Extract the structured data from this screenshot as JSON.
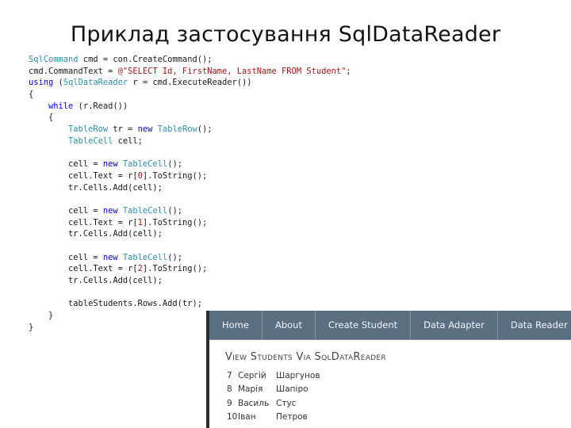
{
  "slide": {
    "title": "Приклад застосування SqlDataReader"
  },
  "code": [
    [
      {
        "t": "type",
        "v": "SqlCommand"
      },
      {
        "t": "plain",
        "v": " cmd = con.CreateCommand();"
      }
    ],
    [
      {
        "t": "plain",
        "v": "cmd.CommandText = "
      },
      {
        "t": "str",
        "v": "@\"SELECT Id, FirstName, LastName FROM Student\""
      },
      {
        "t": "plain",
        "v": ";"
      }
    ],
    [
      {
        "t": "kw",
        "v": "using"
      },
      {
        "t": "plain",
        "v": " ("
      },
      {
        "t": "type",
        "v": "SqlDataReader"
      },
      {
        "t": "plain",
        "v": " r = cmd.ExecuteReader())"
      }
    ],
    [
      {
        "t": "plain",
        "v": "{"
      }
    ],
    [
      {
        "t": "plain",
        "v": "    "
      },
      {
        "t": "kw",
        "v": "while"
      },
      {
        "t": "plain",
        "v": " (r.Read())"
      }
    ],
    [
      {
        "t": "plain",
        "v": "    {"
      }
    ],
    [
      {
        "t": "plain",
        "v": "        "
      },
      {
        "t": "type",
        "v": "TableRow"
      },
      {
        "t": "plain",
        "v": " tr = "
      },
      {
        "t": "kw",
        "v": "new"
      },
      {
        "t": "plain",
        "v": " "
      },
      {
        "t": "type",
        "v": "TableRow"
      },
      {
        "t": "plain",
        "v": "();"
      }
    ],
    [
      {
        "t": "plain",
        "v": "        "
      },
      {
        "t": "type",
        "v": "TableCell"
      },
      {
        "t": "plain",
        "v": " cell;"
      }
    ],
    [
      {
        "t": "plain",
        "v": ""
      }
    ],
    [
      {
        "t": "plain",
        "v": "        cell = "
      },
      {
        "t": "kw",
        "v": "new"
      },
      {
        "t": "plain",
        "v": " "
      },
      {
        "t": "type",
        "v": "TableCell"
      },
      {
        "t": "plain",
        "v": "();"
      }
    ],
    [
      {
        "t": "plain",
        "v": "        cell.Text = r["
      },
      {
        "t": "str",
        "v": "0"
      },
      {
        "t": "plain",
        "v": "].ToString();"
      }
    ],
    [
      {
        "t": "plain",
        "v": "        tr.Cells.Add(cell);"
      }
    ],
    [
      {
        "t": "plain",
        "v": ""
      }
    ],
    [
      {
        "t": "plain",
        "v": "        cell = "
      },
      {
        "t": "kw",
        "v": "new"
      },
      {
        "t": "plain",
        "v": " "
      },
      {
        "t": "type",
        "v": "TableCell"
      },
      {
        "t": "plain",
        "v": "();"
      }
    ],
    [
      {
        "t": "plain",
        "v": "        cell.Text = r["
      },
      {
        "t": "str",
        "v": "1"
      },
      {
        "t": "plain",
        "v": "].ToString();"
      }
    ],
    [
      {
        "t": "plain",
        "v": "        tr.Cells.Add(cell);"
      }
    ],
    [
      {
        "t": "plain",
        "v": ""
      }
    ],
    [
      {
        "t": "plain",
        "v": "        cell = "
      },
      {
        "t": "kw",
        "v": "new"
      },
      {
        "t": "plain",
        "v": " "
      },
      {
        "t": "type",
        "v": "TableCell"
      },
      {
        "t": "plain",
        "v": "();"
      }
    ],
    [
      {
        "t": "plain",
        "v": "        cell.Text = r["
      },
      {
        "t": "str",
        "v": "2"
      },
      {
        "t": "plain",
        "v": "].ToString();"
      }
    ],
    [
      {
        "t": "plain",
        "v": "        tr.Cells.Add(cell);"
      }
    ],
    [
      {
        "t": "plain",
        "v": ""
      }
    ],
    [
      {
        "t": "plain",
        "v": "        tableStudents.Rows.Add(tr);"
      }
    ],
    [
      {
        "t": "plain",
        "v": "    }"
      }
    ],
    [
      {
        "t": "plain",
        "v": "}"
      }
    ]
  ],
  "app": {
    "nav": [
      "Home",
      "About",
      "Create Student",
      "Data Adapter",
      "Data Reader"
    ],
    "heading": "View Students Via SqlDataReader",
    "students": [
      {
        "id": "7",
        "first": "Сергій",
        "last": "Шаргунов"
      },
      {
        "id": "8",
        "first": "Марія",
        "last": "Шапіро"
      },
      {
        "id": "9",
        "first": "Василь",
        "last": "Стус"
      },
      {
        "id": "10",
        "first": "Іван",
        "last": "Петров"
      }
    ]
  },
  "colors": {
    "type": "#2b91af",
    "keyword": "#0000ff",
    "string": "#a31515",
    "navbar": "#5a6e84"
  }
}
